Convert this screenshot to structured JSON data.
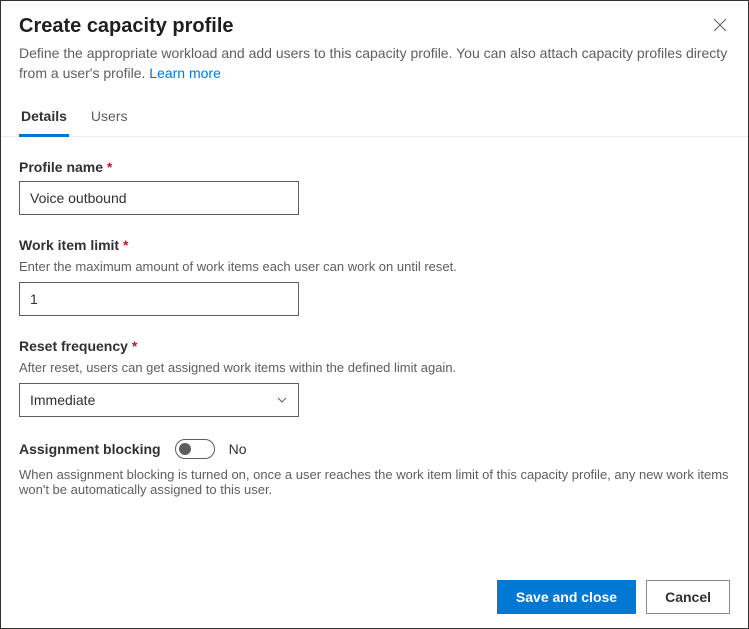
{
  "header": {
    "title": "Create capacity profile",
    "subtitle_before": "Define the appropriate workload and add users to this capacity profile. You can also attach capacity profiles directy from a user's profile. ",
    "learn_more": "Learn more"
  },
  "tabs": {
    "details": "Details",
    "users": "Users"
  },
  "fields": {
    "profile_name": {
      "label": "Profile name",
      "value": "Voice outbound"
    },
    "work_item_limit": {
      "label": "Work item limit",
      "helper": "Enter the maximum amount of work items each user can work on until reset.",
      "value": "1"
    },
    "reset_frequency": {
      "label": "Reset frequency",
      "helper": "After reset, users can get assigned work items within the defined limit again.",
      "value": "Immediate"
    },
    "assignment_blocking": {
      "label": "Assignment blocking",
      "state": "No",
      "helper": "When assignment blocking is turned on, once a user reaches the work item limit of this capacity profile, any new work items won't be automatically assigned to this user."
    }
  },
  "footer": {
    "save": "Save and close",
    "cancel": "Cancel"
  }
}
